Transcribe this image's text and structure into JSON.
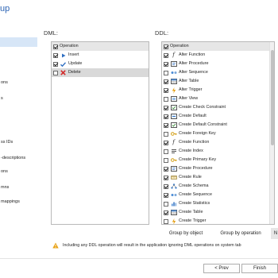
{
  "title": "up",
  "nav": {
    "items": [
      {
        "label": "",
        "selected": true
      },
      {
        "label": "ons",
        "selected": false
      },
      {
        "label": "s",
        "selected": false
      },
      {
        "label": "ss IDs",
        "selected": false
      },
      {
        "label": "-descriptions",
        "selected": false
      },
      {
        "label": "ons",
        "selected": false
      },
      {
        "label": "mns",
        "selected": false
      },
      {
        "label": "mappings",
        "selected": false
      }
    ]
  },
  "dml": {
    "label": "DML:",
    "header": "Operation",
    "items": [
      {
        "label": "Insert",
        "checked": true,
        "icon": "play-icon",
        "selected": false
      },
      {
        "label": "Update",
        "checked": true,
        "icon": "checkmark-icon",
        "selected": false
      },
      {
        "label": "Delete",
        "checked": false,
        "icon": "x-icon",
        "selected": true
      }
    ]
  },
  "ddl": {
    "label": "DDL:",
    "header": "Operation",
    "items": [
      {
        "label": "Alter Function",
        "checked": true,
        "icon": "function-icon"
      },
      {
        "label": "Alter Procedure",
        "checked": true,
        "icon": "procedure-icon"
      },
      {
        "label": "Alter Sequence",
        "checked": false,
        "icon": "sequence-icon"
      },
      {
        "label": "Alter Table",
        "checked": true,
        "icon": "table-icon"
      },
      {
        "label": "Alter Trigger",
        "checked": true,
        "icon": "trigger-icon"
      },
      {
        "label": "Alter View",
        "checked": false,
        "icon": "view-icon"
      },
      {
        "label": "Create Check Constraint",
        "checked": true,
        "icon": "constraint-icon"
      },
      {
        "label": "Create Default",
        "checked": true,
        "icon": "default-icon"
      },
      {
        "label": "Create Default Constraint",
        "checked": true,
        "icon": "constraint-icon"
      },
      {
        "label": "Create Foreign Key",
        "checked": false,
        "icon": "key-icon"
      },
      {
        "label": "Create Function",
        "checked": true,
        "icon": "function-icon"
      },
      {
        "label": "Create Index",
        "checked": false,
        "icon": "index-icon"
      },
      {
        "label": "Create Primary Key",
        "checked": false,
        "icon": "key-icon"
      },
      {
        "label": "Create Procedure",
        "checked": true,
        "icon": "procedure-icon"
      },
      {
        "label": "Create Rule",
        "checked": true,
        "icon": "rule-icon"
      },
      {
        "label": "Create Schema",
        "checked": true,
        "icon": "schema-icon"
      },
      {
        "label": "Create Sequence",
        "checked": true,
        "icon": "sequence-icon"
      },
      {
        "label": "Create Statistics",
        "checked": false,
        "icon": "statistics-icon"
      },
      {
        "label": "Create Table",
        "checked": true,
        "icon": "table-icon"
      },
      {
        "label": "Create Trigger",
        "checked": false,
        "icon": "trigger-icon"
      }
    ]
  },
  "grouping": {
    "group_by_object": "Group by object",
    "group_by_operation": "Group by operation",
    "third": "N"
  },
  "warning": {
    "text": "Including any DDL operation will result in the application ignoring DML operations on system tab"
  },
  "buttons": {
    "prev": "< Prev",
    "finish": "Finish"
  },
  "colors": {
    "title": "#2b63b4",
    "selected_nav": "#d7e6f7",
    "header_row": "#e6e6e6"
  }
}
